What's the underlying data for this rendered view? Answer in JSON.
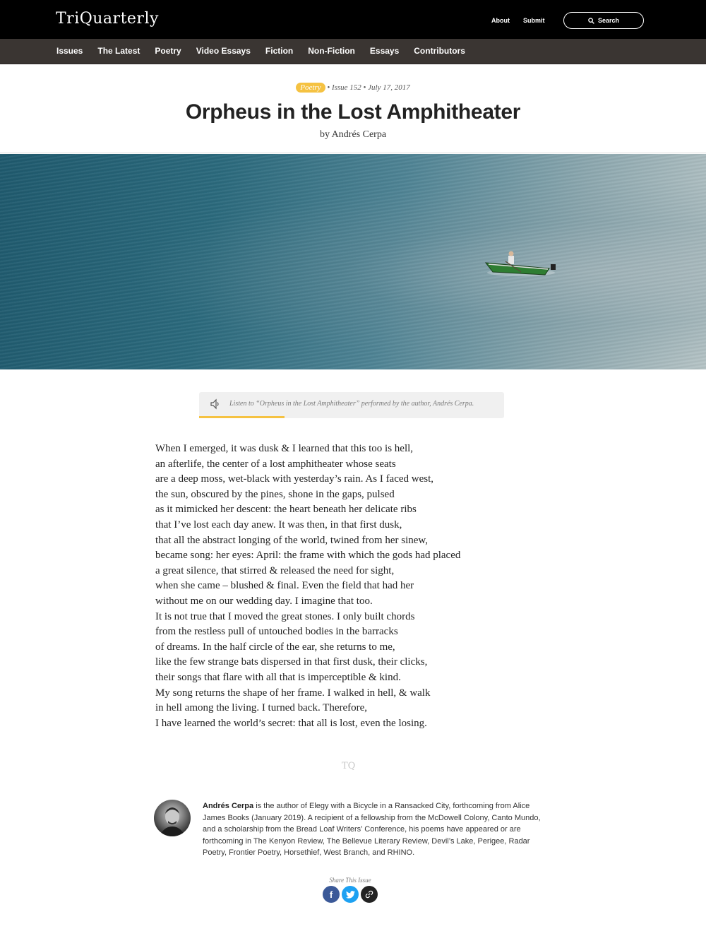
{
  "header": {
    "logo": "TriQuarterly",
    "links": [
      "About",
      "Submit"
    ],
    "search_label": "Search"
  },
  "nav": {
    "items": [
      "Issues",
      "The Latest",
      "Poetry",
      "Video Essays",
      "Fiction",
      "Non-Fiction",
      "Essays",
      "Contributors"
    ]
  },
  "article": {
    "category": "Poetry",
    "issue": "Issue 152",
    "date": "July 17, 2017",
    "title": "Orpheus in the Lost Amphitheater",
    "byline": "by Andrés Cerpa"
  },
  "audio": {
    "caption": "Listen to “Orpheus in the Lost Amphitheater” performed by the author, Andrés Cerpa.",
    "progress": 0.28
  },
  "poem": {
    "lines": [
      "When I emerged, it was dusk & I learned that this too is hell,",
      "an afterlife, the center of a lost amphitheater whose seats",
      "are a deep moss, wet-black with yesterday’s rain. As I faced west,",
      "the sun, obscured by the pines, shone in the gaps, pulsed",
      "as it mimicked her descent: the heart beneath her delicate ribs",
      "that I’ve lost each day anew. It was then, in that first dusk,",
      "that all the abstract longing of the world, twined from her sinew,",
      "became song: her eyes: April: the frame with which the gods had placed",
      "a great silence, that stirred & released the need for sight,",
      "when she came – blushed & final. Even the field that had her",
      "without me on our wedding day. I imagine that too.",
      "It is not true that I moved the great stones. I only built chords",
      "from the restless pull of untouched bodies in the barracks",
      "of dreams. In the half circle of the ear, she returns to me,",
      "like the few strange bats dispersed in that first dusk, their clicks,",
      "their songs that flare with all that is imperceptible & kind.",
      "My song returns the shape of her frame. I walked in hell, & walk",
      "in hell among the living. I turned back. Therefore,",
      "I have learned the world’s secret: that all is lost, even the losing."
    ]
  },
  "footer_mark": "TQ",
  "author": {
    "name": "Andrés Cerpa",
    "bio": " is the author of Elegy with a Bicycle in a Ransacked City, forthcoming from Alice James Books (January 2019). A recipient of a fellowship from the McDowell Colony, Canto Mundo, and a scholarship from the Bread Loaf Writers’ Conference, his poems have appeared or are forthcoming in The Kenyon Review, The Bellevue Literary Review, Devil’s Lake, Perigee, Radar Poetry, Frontier Poetry, Horsethief, West Branch, and RHINO."
  },
  "share": {
    "label": "Share This Issue",
    "buttons": [
      {
        "icon": "facebook-icon",
        "glyph": "f",
        "color": "#3b5998"
      },
      {
        "icon": "twitter-icon",
        "glyph": "t",
        "color": "#1da1f2"
      },
      {
        "icon": "link-icon",
        "glyph": "",
        "color": "#222222"
      }
    ]
  },
  "colors": {
    "accent": "#f5c242",
    "topbar": "#000000",
    "navbar": "#3a3532"
  }
}
